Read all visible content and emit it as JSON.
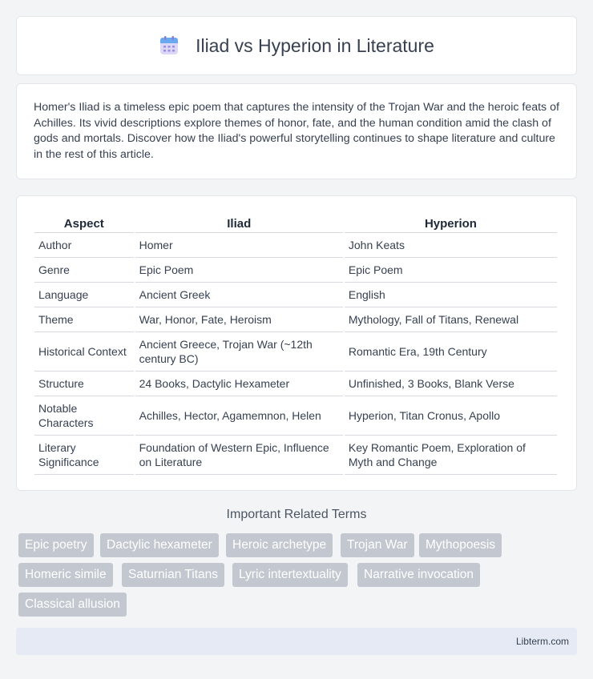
{
  "header": {
    "title": "Iliad vs Hyperion in Literature",
    "icon": "calendar-icon"
  },
  "intro": {
    "text": "Homer's Iliad is a timeless epic poem that captures the intensity of the Trojan War and the heroic feats of Achilles. Its vivid descriptions explore themes of honor, fate, and the human condition amid the clash of gods and mortals. Discover how the Iliad's powerful storytelling continues to shape literature and culture in the rest of this article."
  },
  "table": {
    "headers": [
      "Aspect",
      "Iliad",
      "Hyperion"
    ],
    "rows": [
      [
        "Author",
        "Homer",
        "John Keats"
      ],
      [
        "Genre",
        "Epic Poem",
        "Epic Poem"
      ],
      [
        "Language",
        "Ancient Greek",
        "English"
      ],
      [
        "Theme",
        "War, Honor, Fate, Heroism",
        "Mythology, Fall of Titans, Renewal"
      ],
      [
        "Historical Context",
        "Ancient Greece, Trojan War (~12th century BC)",
        "Romantic Era, 19th Century"
      ],
      [
        "Structure",
        "24 Books, Dactylic Hexameter",
        "Unfinished, 3 Books, Blank Verse"
      ],
      [
        "Notable Characters",
        "Achilles, Hector, Agamemnon, Helen",
        "Hyperion, Titan Cronus, Apollo"
      ],
      [
        "Literary Significance",
        "Foundation of Western Epic, Influence on Literature",
        "Key Romantic Poem, Exploration of Myth and Change"
      ]
    ]
  },
  "related": {
    "title": "Important Related Terms",
    "tags": [
      "Epic poetry",
      "Dactylic hexameter",
      "Heroic archetype",
      "Trojan War",
      "Mythopoesis",
      "Homeric simile",
      "Saturnian Titans",
      "Lyric intertextuality",
      "Narrative invocation",
      "Classical allusion"
    ]
  },
  "footer": {
    "site": "Libterm.com"
  },
  "colors": {
    "tag_bg": "#c3c8d0",
    "footer_bg": "#e5eaf4",
    "page_bg": "#f3f4f6"
  }
}
